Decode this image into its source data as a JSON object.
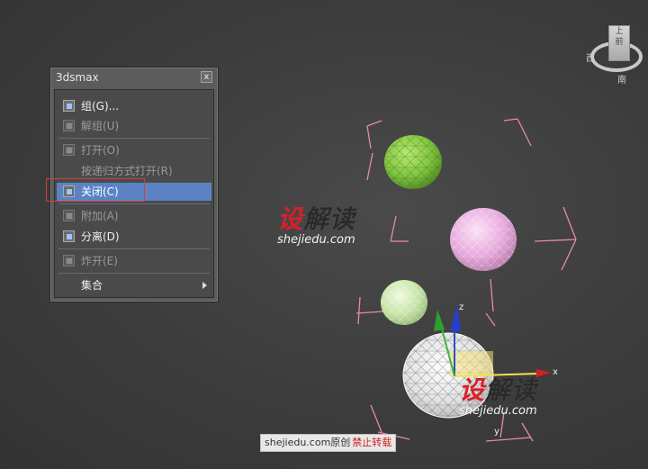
{
  "panel": {
    "title": "3dsmax",
    "close_label": "x",
    "items": [
      {
        "label": "组(G)...",
        "state": "enabled",
        "icon": "group-icon"
      },
      {
        "label": "解组(U)",
        "state": "disabled",
        "icon": "ungroup-icon"
      },
      {
        "label": "打开(O)",
        "state": "disabled",
        "icon": "open-icon"
      },
      {
        "label": "按递归方式打开(R)",
        "state": "disabled",
        "icon": ""
      },
      {
        "label": "关闭(C)",
        "state": "highlighted",
        "icon": "close-group-icon"
      },
      {
        "label": "附加(A)",
        "state": "disabled",
        "icon": "attach-icon"
      },
      {
        "label": "分离(D)",
        "state": "enabled",
        "icon": "detach-icon"
      },
      {
        "label": "炸开(E)",
        "state": "disabled",
        "icon": "explode-icon"
      },
      {
        "label": "集合",
        "state": "enabled",
        "icon": "",
        "submenu": true
      }
    ]
  },
  "viewcube": {
    "front": "前",
    "top": "上",
    "west": "西",
    "south": "南"
  },
  "watermark": {
    "brand_red": "设",
    "brand_dark": "解读",
    "url": "shejiedu.com",
    "footer_site": "shejiedu.com原创",
    "footer_warning": "禁止转载"
  },
  "gizmo": {
    "x_label": "x",
    "y_label": "y",
    "z_label": "z"
  },
  "colors": {
    "highlight": "#5b83c4",
    "bbox_pink": "#e88aa8",
    "sphere_green": "#7ec83a",
    "sphere_pink": "#e6a8dc",
    "sphere_light_green": "#c6e4a6",
    "sphere_white": "#e8e8e8",
    "selection_red": "#d04040"
  }
}
